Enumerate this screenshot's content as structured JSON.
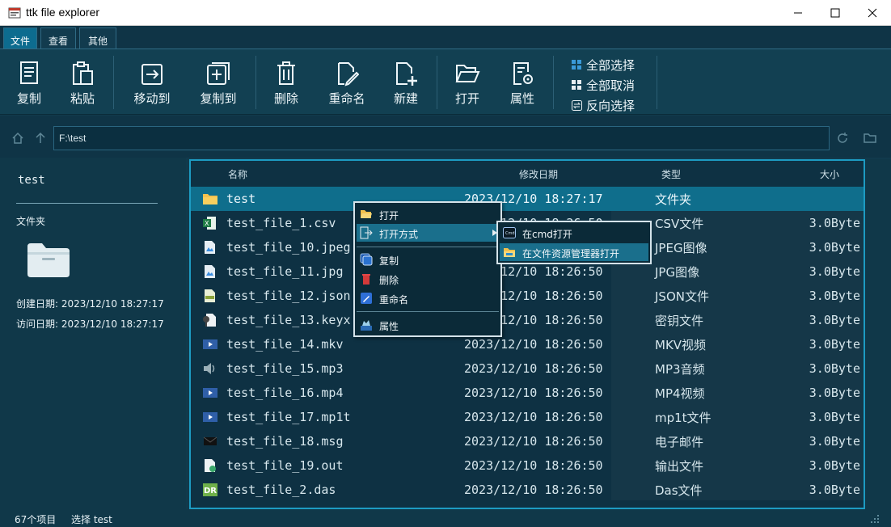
{
  "window": {
    "title": "ttk file explorer"
  },
  "tabs": [
    {
      "label": "文件",
      "active": true
    },
    {
      "label": "查看",
      "active": false
    },
    {
      "label": "其他",
      "active": false
    }
  ],
  "ribbon": {
    "copy": "复制",
    "paste": "粘贴",
    "move_to": "移动到",
    "copy_to": "复制到",
    "delete": "删除",
    "rename": "重命名",
    "new": "新建",
    "open": "打开",
    "properties": "属性",
    "select_all": "全部选择",
    "deselect_all": "全部取消",
    "invert_selection": "反向选择"
  },
  "path": {
    "value": "F:\\test"
  },
  "sidebar": {
    "name": "test",
    "kind": "文件夹",
    "created": "创建日期: 2023/12/10 18:27:17",
    "accessed": "访问日期: 2023/12/10 18:27:17"
  },
  "columns": {
    "name": "名称",
    "modified": "修改日期",
    "type": "类型",
    "size": "大小"
  },
  "files": [
    {
      "name": "test",
      "date": "2023/12/10 18:27:17",
      "type": "文件夹",
      "size": "",
      "icon": "folder-icon",
      "selected": true
    },
    {
      "name": "test_file_1.csv",
      "date": "2023/12/10 18:26:50",
      "type": "CSV文件",
      "size": "3.0Byte",
      "icon": "csv-file-icon"
    },
    {
      "name": "test_file_10.jpeg",
      "date": "2023/12/10 18:26:50",
      "type": "JPEG图像",
      "size": "3.0Byte",
      "icon": "image-file-icon"
    },
    {
      "name": "test_file_11.jpg",
      "date": "2023/12/10 18:26:50",
      "type": "JPG图像",
      "size": "3.0Byte",
      "icon": "image-file-icon"
    },
    {
      "name": "test_file_12.json",
      "date": "2023/12/10 18:26:50",
      "type": "JSON文件",
      "size": "3.0Byte",
      "icon": "json-file-icon"
    },
    {
      "name": "test_file_13.keyx",
      "date": "2023/12/10 18:26:50",
      "type": "密钥文件",
      "size": "3.0Byte",
      "icon": "key-file-icon"
    },
    {
      "name": "test_file_14.mkv",
      "date": "2023/12/10 18:26:50",
      "type": "MKV视频",
      "size": "3.0Byte",
      "icon": "video-file-icon"
    },
    {
      "name": "test_file_15.mp3",
      "date": "2023/12/10 18:26:50",
      "type": "MP3音频",
      "size": "3.0Byte",
      "icon": "audio-file-icon"
    },
    {
      "name": "test_file_16.mp4",
      "date": "2023/12/10 18:26:50",
      "type": "MP4视频",
      "size": "3.0Byte",
      "icon": "video-file-icon"
    },
    {
      "name": "test_file_17.mp1t",
      "date": "2023/12/10 18:26:50",
      "type": "mp1t文件",
      "size": "3.0Byte",
      "icon": "video-file-icon"
    },
    {
      "name": "test_file_18.msg",
      "date": "2023/12/10 18:26:50",
      "type": "电子邮件",
      "size": "3.0Byte",
      "icon": "mail-file-icon"
    },
    {
      "name": "test_file_19.out",
      "date": "2023/12/10 18:26:50",
      "type": "输出文件",
      "size": "3.0Byte",
      "icon": "output-file-icon"
    },
    {
      "name": "test_file_2.das",
      "date": "2023/12/10 18:26:50",
      "type": "Das文件",
      "size": "3.0Byte",
      "icon": "das-file-icon"
    }
  ],
  "context_menu": {
    "open": "打开",
    "open_with": "打开方式",
    "copy": "复制",
    "delete": "删除",
    "rename": "重命名",
    "properties": "属性"
  },
  "submenu": {
    "open_in_cmd": "在cmd打开",
    "open_in_explorer": "在文件资源管理器打开"
  },
  "status": {
    "count": "67个项目",
    "selection": "选择 test"
  }
}
